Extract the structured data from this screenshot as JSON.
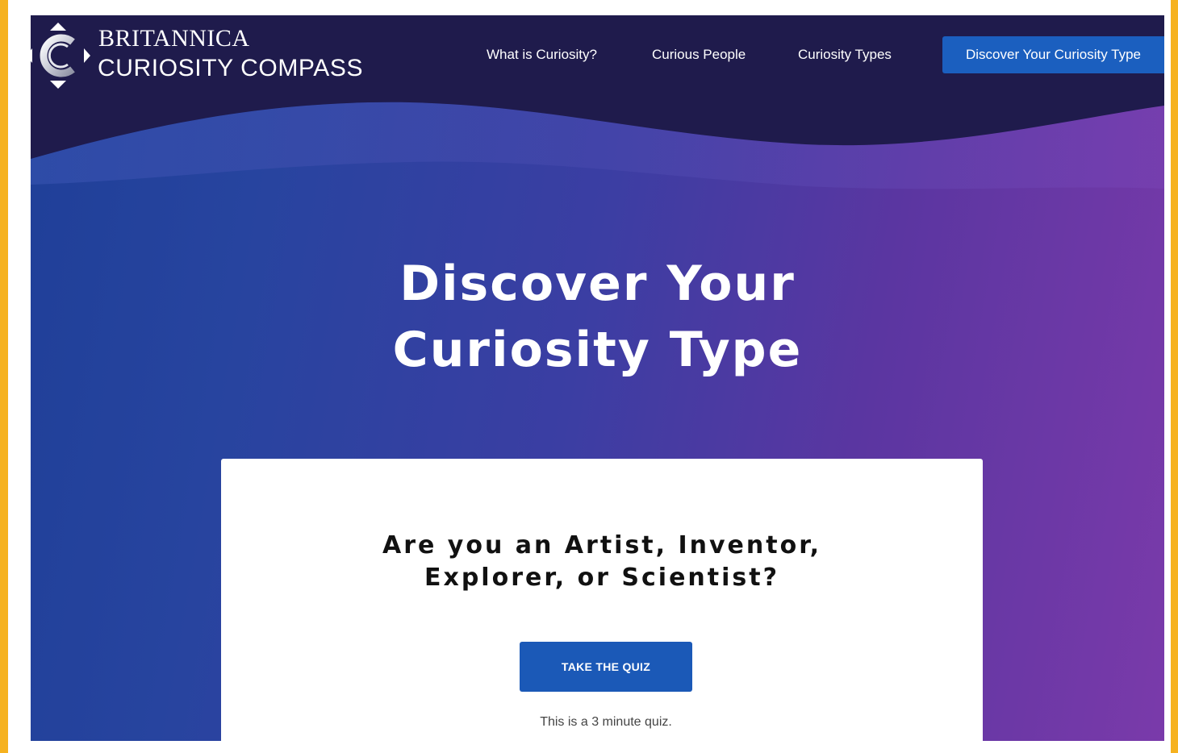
{
  "header": {
    "brand_line1": "BRITANNICA",
    "brand_line2": "CURIOSITY COMPASS",
    "logo_icon": "compass-c-icon",
    "nav": {
      "what_is_curiosity": "What is Curiosity?",
      "curious_people": "Curious People",
      "curiosity_types": "Curiosity Types",
      "discover_type": "Discover Your Curiosity Type"
    }
  },
  "hero": {
    "title_line1": "Discover Your",
    "title_line2": "Curiosity Type"
  },
  "card": {
    "question_line1": "Are you an Artist, Inventor,",
    "question_line2": "Explorer, or Scientist?",
    "button_label": "TAKE THE QUIZ",
    "note": "This is a 3 minute quiz."
  },
  "colors": {
    "frame": "#f6b21f",
    "header_dark": "#1f1b4c",
    "hero_blue": "#1f3f98",
    "hero_purple": "#7a3aaa",
    "accent_button": "#1b5fbf"
  }
}
